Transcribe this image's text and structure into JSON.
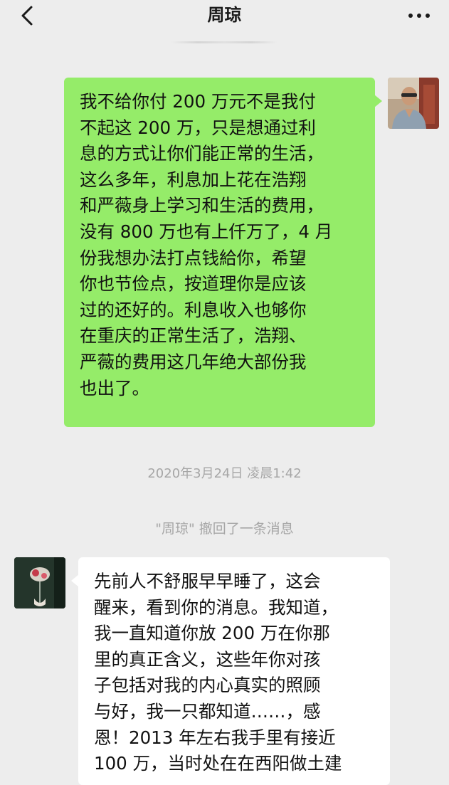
{
  "header": {
    "title": "周琼",
    "back_icon": "chevron-left-icon",
    "more_icon": "more-dots-icon"
  },
  "messages": [
    {
      "side": "right",
      "bubble_color": "#95ec69",
      "lines": [
        "我不给你付 200 万元不是我付",
        "不起这 200 万，只是想通过利",
        "息的方式让你们能正常的生活，",
        "这么多年，利息加上花在浩翔",
        "和严薇身上学习和生活的费用，",
        "没有 800 万也有上仟万了，4 月",
        "份我想办法打点钱給你，希望",
        "你也节俭点，按道理你是应该",
        "过的还好的。利息收入也够你",
        "在重庆的正常生活了，浩翔、",
        "严薇的费用这几年绝大部份我",
        "也出了。"
      ]
    },
    {
      "side": "left",
      "bubble_color": "#ffffff",
      "lines": [
        "先前人不舒服早早睡了，这会",
        "醒来，看到你的消息。我知道，",
        "我一直知道你放 200 万在你那",
        "里的真正含义，这些年你对孩",
        "子包括对我的内心真实的照顾",
        "与好，我一只都知道……，感",
        "恩！2013 年左右我手里有接近",
        "100 万，当时处在在西阳做土建"
      ]
    }
  ],
  "system": {
    "timestamp": "2020年3月24日 凌晨1:42",
    "recall_notice": "\"周琼\" 撤回了一条消息"
  },
  "colors": {
    "background": "#ededed",
    "sent_bubble": "#95ec69",
    "received_bubble": "#ffffff",
    "system_text": "#a6a6a6"
  }
}
